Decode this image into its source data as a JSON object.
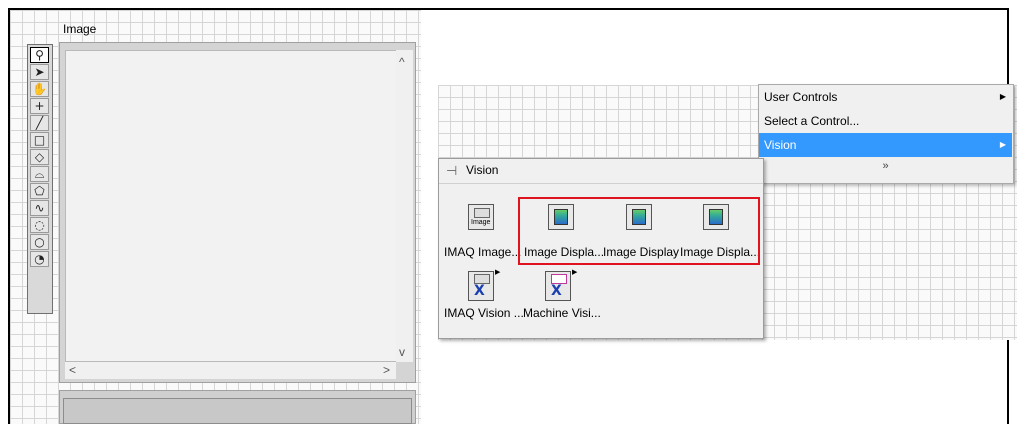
{
  "image_control": {
    "label": "Image",
    "tools": [
      "zoom-tool",
      "pointer-tool",
      "pan-tool",
      "point-tool",
      "line-tool",
      "rectangle-tool",
      "rotated-rectangle-tool",
      "annulus-tool",
      "polygon-tool",
      "freehand-line-tool",
      "freehand-region-tool",
      "oval-tool",
      "broken-annulus-tool"
    ]
  },
  "context_menu": {
    "items": [
      {
        "label": "User Controls",
        "has_submenu": true
      },
      {
        "label": "Select a Control...",
        "has_submenu": false
      },
      {
        "label": "Vision",
        "has_submenu": true,
        "selected": true
      }
    ],
    "more_label": "»"
  },
  "palette": {
    "title": "Vision",
    "items": [
      {
        "label": "IMAQ Image...",
        "icon": "imaq-image-icon",
        "icon_text": "Image"
      },
      {
        "label": "Image Displa...",
        "icon": "image-display-icon"
      },
      {
        "label": "Image Display",
        "icon": "image-display-icon"
      },
      {
        "label": "Image Displa...",
        "icon": "image-display-icon"
      },
      {
        "label": "IMAQ Vision ...",
        "icon": "imaq-vision-icon"
      },
      {
        "label": "Machine Visi...",
        "icon": "machine-vision-icon"
      }
    ]
  },
  "colors": {
    "highlight": "#3399ff",
    "annotation": "#e0141e"
  }
}
